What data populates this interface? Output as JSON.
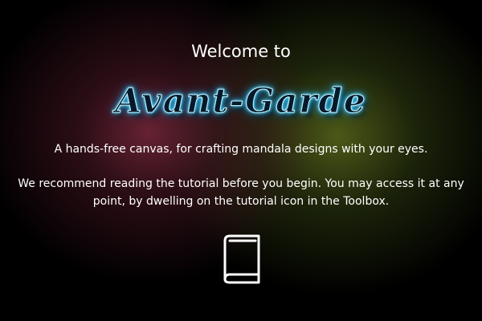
{
  "welcome": {
    "greeting": "Welcome to",
    "app_name": "Avant-Garde",
    "tagline": "A hands-free canvas, for crafting mandala designs with your eyes.",
    "recommendation": "We recommend reading the tutorial before you begin. You may access it at any point, by dwelling on the tutorial icon in the Toolbox."
  },
  "icons": {
    "tutorial": "book-icon"
  },
  "colors": {
    "background": "#000000",
    "text": "#ffffff",
    "title_glow": "#2bb8f0",
    "left_glow": "#782840",
    "right_glow": "#5f6e1e"
  }
}
